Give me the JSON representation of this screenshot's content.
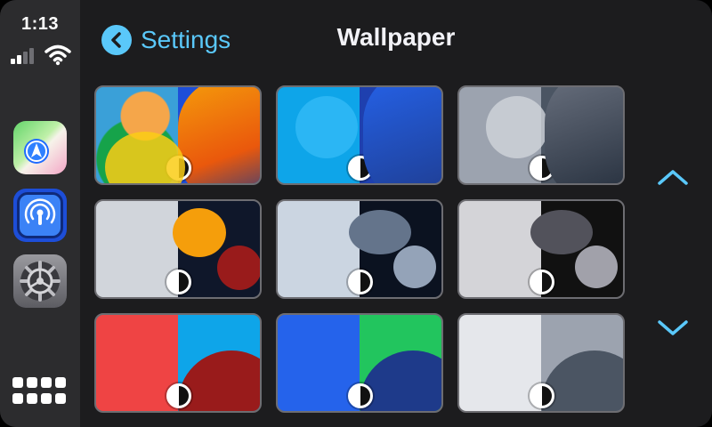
{
  "status": {
    "time": "1:13",
    "signal_bars": 2
  },
  "sidebar": {
    "apps": [
      {
        "name": "Maps",
        "icon": "maps-icon"
      },
      {
        "name": "Podcasts",
        "icon": "podcasts-icon"
      },
      {
        "name": "Settings",
        "icon": "settings-gear-icon"
      }
    ],
    "app_grid_icon": "app-grid-icon"
  },
  "header": {
    "back_label": "Settings",
    "title": "Wallpaper"
  },
  "wallpapers": [
    {
      "name": "wallpaper-1",
      "theme_icon": "appearance-toggle-icon"
    },
    {
      "name": "wallpaper-2",
      "theme_icon": "appearance-toggle-icon"
    },
    {
      "name": "wallpaper-3",
      "theme_icon": "appearance-toggle-icon"
    },
    {
      "name": "wallpaper-4",
      "theme_icon": "appearance-toggle-icon"
    },
    {
      "name": "wallpaper-5",
      "theme_icon": "appearance-toggle-icon"
    },
    {
      "name": "wallpaper-6",
      "theme_icon": "appearance-toggle-icon"
    },
    {
      "name": "wallpaper-7",
      "theme_icon": "appearance-toggle-icon"
    },
    {
      "name": "wallpaper-8",
      "theme_icon": "appearance-toggle-icon"
    },
    {
      "name": "wallpaper-9",
      "theme_icon": "appearance-toggle-icon"
    }
  ],
  "colors": {
    "accent": "#5ac8fa",
    "background": "#1c1c1e",
    "sidebar": "#2c2c2e"
  }
}
